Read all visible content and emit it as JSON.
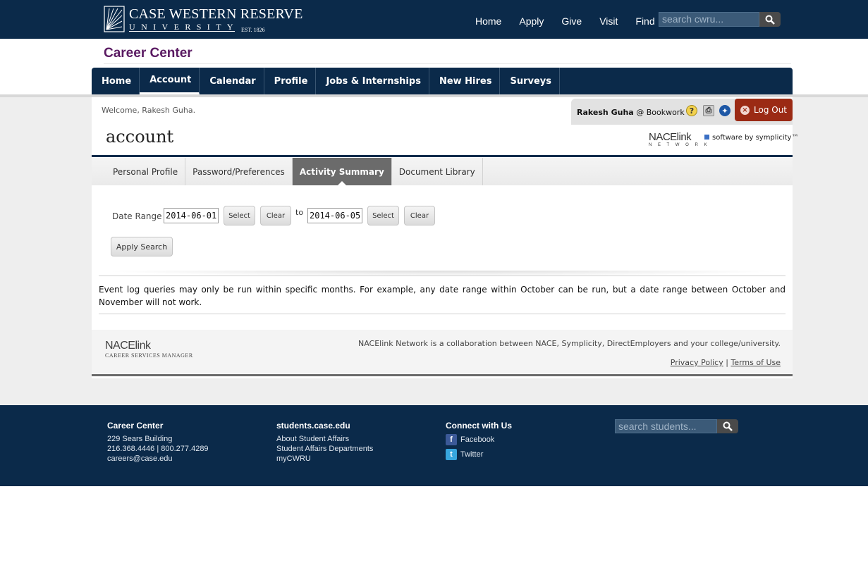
{
  "header": {
    "logo_line1": "CASE WESTERN RESERVE",
    "logo_line2": "UNIVERSITY",
    "logo_est": "EST. 1826",
    "nav": [
      "Home",
      "Apply",
      "Give",
      "Visit",
      "Find"
    ],
    "search_placeholder": "search cwru..."
  },
  "site_title": "Career Center",
  "main_nav": [
    "Home",
    "Account",
    "Calendar",
    "Profile",
    "Jobs & Internships",
    "New Hires",
    "Surveys"
  ],
  "main_nav_active": "Account",
  "welcome": "Welcome, Rakesh Guha.",
  "user": {
    "name": "Rakesh Guha",
    "org": "@ Bookwork"
  },
  "logout_label": "Log Out",
  "page_title": "account",
  "nace_logo": {
    "line1": "NACElink",
    "line2": "N E T W O R K"
  },
  "symplicity": "software by symplicity™",
  "tabs": [
    "Personal Profile",
    "Password/Preferences",
    "Activity Summary",
    "Document Library"
  ],
  "tab_active": "Activity Summary",
  "form": {
    "date_range_label": "Date Range",
    "from_value": "2014-06-01",
    "to_label": "to",
    "to_value": "2014-06-05",
    "select_label": "Select",
    "clear_label": "Clear",
    "apply_label": "Apply Search"
  },
  "note": "Event log queries may only be run within specific months. For example, any date range within October can be run, but a date range between October and November will not work.",
  "inner_footer": {
    "logo_line1": "NACElink",
    "logo_line2": "CAREER SERVICES MANAGER",
    "collab": "NACElink Network is a collaboration between NACE, Symplicity, DirectEmployers and your college/university.",
    "privacy": "Privacy Policy",
    "sep": "|",
    "terms": "Terms of Use"
  },
  "site_footer": {
    "col1": {
      "title": "Career Center",
      "lines": [
        "229 Sears Building",
        "216.368.4446 | 800.277.4289",
        "careers@case.edu"
      ]
    },
    "col2": {
      "title": "students.case.edu",
      "lines": [
        "About Student Affairs",
        "Student Affairs Departments",
        "myCWRU"
      ]
    },
    "col3": {
      "title": "Connect with Us",
      "facebook": "Facebook",
      "twitter": "Twitter"
    },
    "search_placeholder": "search students..."
  },
  "colors": {
    "navy": "#0b2a4a",
    "purple_title": "#5a1a62",
    "logout_red": "#9b2a14",
    "active_tab": "#6b6b6b"
  }
}
